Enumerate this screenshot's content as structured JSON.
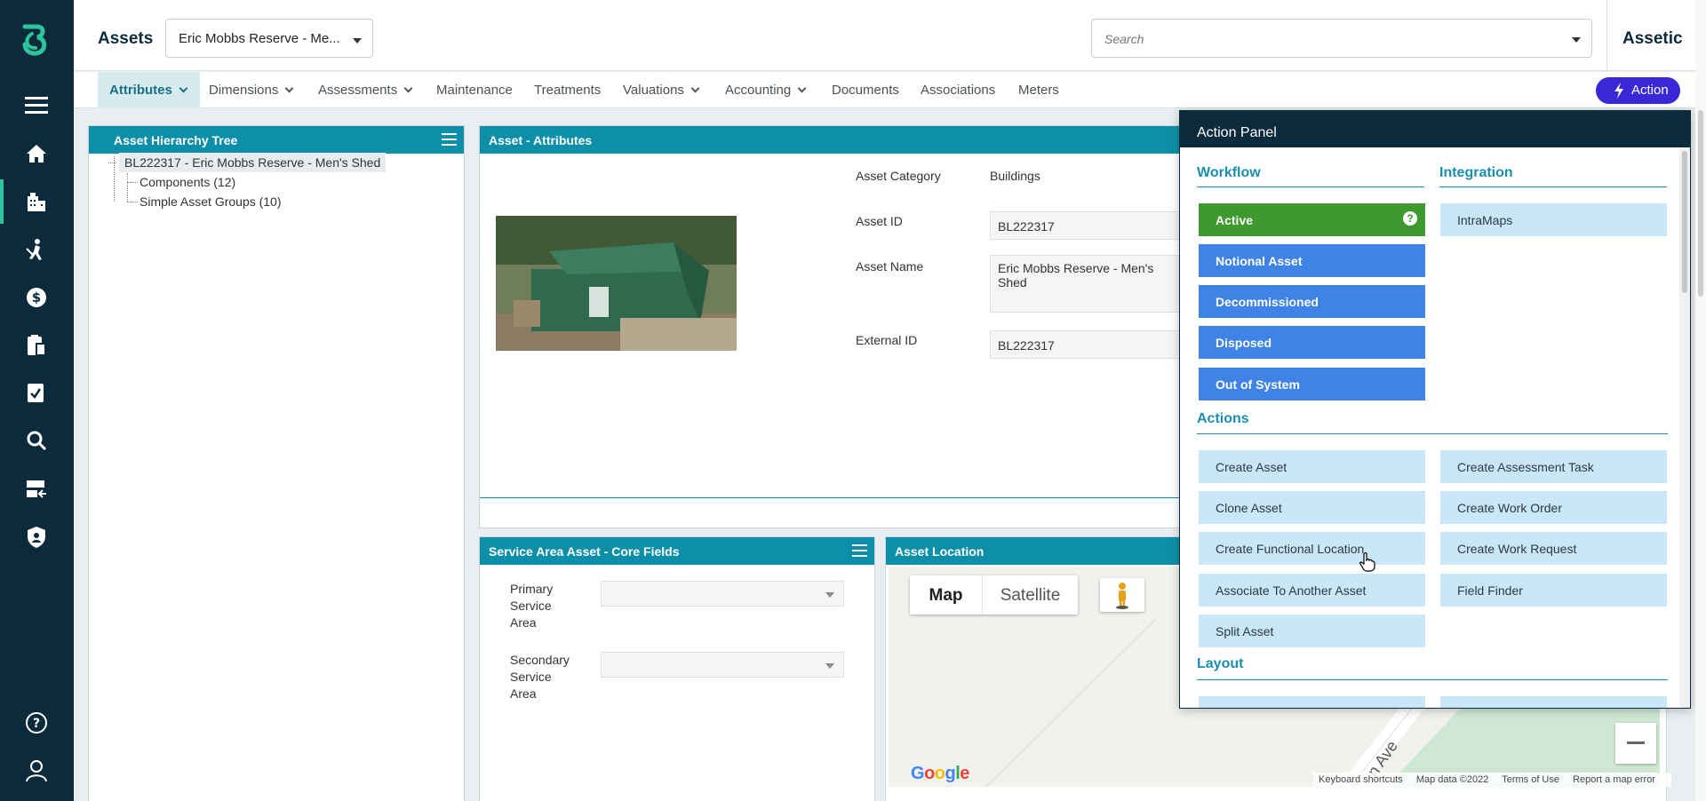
{
  "sidebar": {
    "icons": [
      "logo-icon",
      "menu-icon",
      "home-icon",
      "buildings-icon",
      "worker-icon",
      "dollar-icon",
      "clipboard-icon",
      "task-icon",
      "search-icon",
      "server-icon",
      "shield-icon",
      "help-icon",
      "user-icon"
    ]
  },
  "header": {
    "title": "Assets",
    "asset_selector": "Eric Mobbs Reserve - Me...",
    "search_placeholder": "Search",
    "brand": "Assetic"
  },
  "tabs": [
    {
      "label": "Attributes",
      "has_menu": true,
      "active": true
    },
    {
      "label": "Dimensions",
      "has_menu": true
    },
    {
      "label": "Assessments",
      "has_menu": true
    },
    {
      "label": "Maintenance"
    },
    {
      "label": "Treatments"
    },
    {
      "label": "Valuations",
      "has_menu": true
    },
    {
      "label": "Accounting",
      "has_menu": true
    },
    {
      "label": "Documents"
    },
    {
      "label": "Associations"
    },
    {
      "label": "Meters"
    }
  ],
  "action_button": "Action",
  "hierarchy": {
    "title": "Asset Hierarchy Tree",
    "root": "BL222317 - Eric Mobbs Reserve - Men's Shed",
    "children": [
      "Components (12)",
      "Simple Asset Groups (10)"
    ]
  },
  "attributes": {
    "title": "Asset - Attributes",
    "category_label": "Asset Category",
    "category_value": "Buildings",
    "id_label": "Asset ID",
    "id_value": "BL222317",
    "name_label": "Asset Name",
    "name_value": "Eric Mobbs Reserve - Men's Shed",
    "external_label": "External ID",
    "external_value": "BL222317"
  },
  "service_area": {
    "title": "Service Area Asset - Core Fields",
    "primary_label": "Primary Service Area",
    "secondary_label": "Secondary Service Area"
  },
  "location": {
    "title": "Asset Location",
    "map_tab": "Map",
    "satellite_tab": "Satellite",
    "street_label": "n Ave",
    "google": "Google",
    "footer": [
      "Keyboard shortcuts",
      "Map data ©2022",
      "Terms of Use",
      "Report a map error"
    ]
  },
  "action_panel": {
    "title": "Action Panel",
    "workflow_title": "Workflow",
    "integration_title": "Integration",
    "actions_title": "Actions",
    "layout_title": "Layout",
    "workflow": [
      {
        "label": "Active",
        "style": "green"
      },
      {
        "label": "Notional Asset",
        "style": "blue"
      },
      {
        "label": "Decommissioned",
        "style": "blue"
      },
      {
        "label": "Disposed",
        "style": "blue"
      },
      {
        "label": "Out of System",
        "style": "blue"
      }
    ],
    "integration": [
      "IntraMaps"
    ],
    "actions_left": [
      "Create Asset",
      "Clone Asset",
      "Create Functional Location",
      "Associate To Another Asset",
      "Split Asset"
    ],
    "actions_right": [
      "Create Assessment Task",
      "Create Work Order",
      "Create Work Request",
      "Field Finder"
    ]
  },
  "colors": {
    "sidebar": "#0b2a3c",
    "panel_header": "#0e8fa9",
    "workflow_active": "#3e9a2e",
    "workflow_state": "#3f83e6",
    "action_light": "#c9e7f8",
    "action_button": "#3a27d6"
  }
}
